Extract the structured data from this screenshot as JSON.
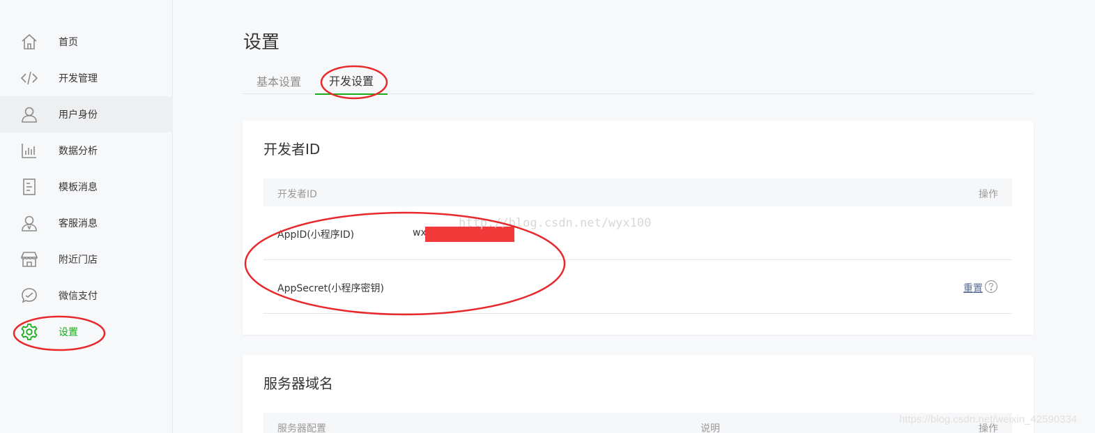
{
  "sidebar": {
    "items": [
      {
        "label": "首页",
        "icon": "home-icon"
      },
      {
        "label": "开发管理",
        "icon": "code-icon"
      },
      {
        "label": "用户身份",
        "icon": "user-icon"
      },
      {
        "label": "数据分析",
        "icon": "chart-icon"
      },
      {
        "label": "模板消息",
        "icon": "document-icon"
      },
      {
        "label": "客服消息",
        "icon": "customer-service-icon"
      },
      {
        "label": "附近门店",
        "icon": "store-icon"
      },
      {
        "label": "微信支付",
        "icon": "wechat-pay-icon"
      },
      {
        "label": "设置",
        "icon": "gear-icon"
      }
    ],
    "active_index": 8,
    "hover_index": 2
  },
  "page": {
    "title": "设置",
    "tabs": [
      {
        "label": "基本设置"
      },
      {
        "label": "开发设置"
      }
    ],
    "active_tab": 1
  },
  "dev_id": {
    "title": "开发者ID",
    "header_id": "开发者ID",
    "header_op": "操作",
    "rows": [
      {
        "name": "AppID(小程序ID)",
        "value": "wx"
      },
      {
        "name": "AppSecret(小程序密钥)",
        "action": "重置"
      }
    ]
  },
  "server": {
    "title": "服务器域名",
    "header_config": "服务器配置",
    "header_desc": "说明",
    "header_op": "操作"
  },
  "watermarks": {
    "blog": "http://blog.csdn.net/wyx100",
    "footer": "https://blog.csdn.net/weixin_42590334"
  },
  "colors": {
    "accent": "#1aad19",
    "link": "#576b95",
    "annotation": "#e8292c",
    "redaction": "#f23a3a"
  }
}
